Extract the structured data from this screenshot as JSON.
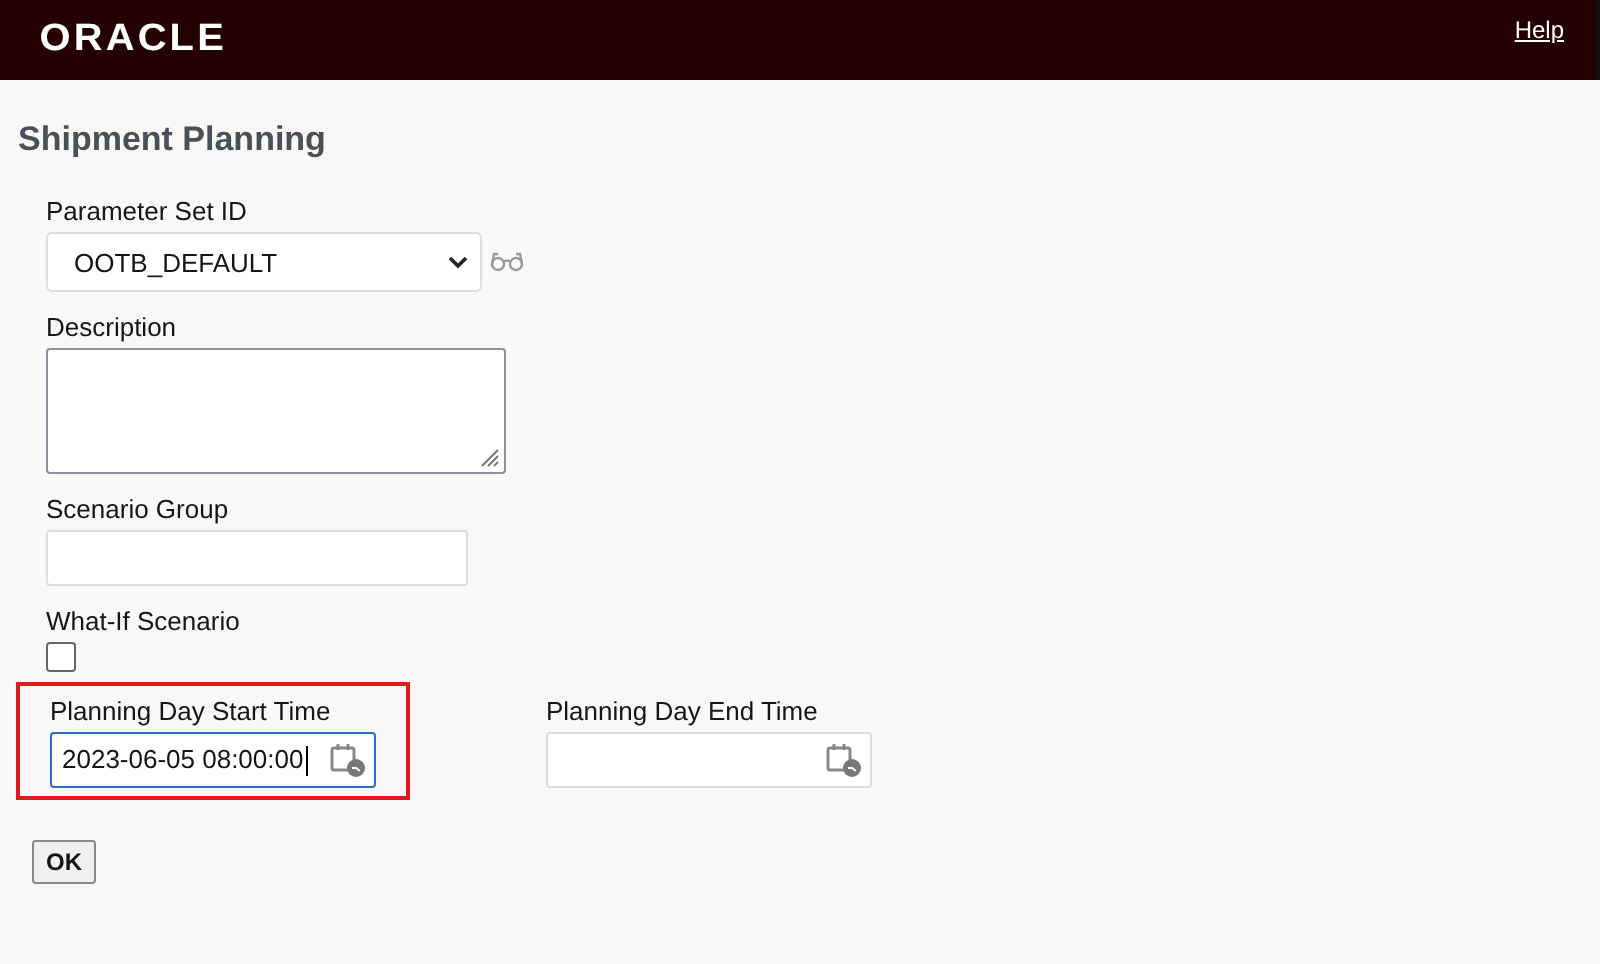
{
  "header": {
    "logo": "ORACLE",
    "help_link": "Help"
  },
  "page_title": "Shipment Planning",
  "fields": [
    {
      "kind": "select",
      "label": "Parameter Set ID",
      "value": "OOTB_DEFAULT"
    },
    {
      "kind": "textarea",
      "label": "Description"
    },
    {
      "kind": "text",
      "label": "Scenario Group"
    },
    {
      "kind": "checkbox",
      "label": "What-If Scenario",
      "checked": false
    }
  ],
  "time_fields": [
    {
      "label": "Planning Day Start Time",
      "value": "2023-06-05 08:00:00",
      "focused": true,
      "highlighted": true
    },
    {
      "label": "Planning Day End Time",
      "focused": false,
      "highlighted": false
    }
  ],
  "ok_button": "OK"
}
